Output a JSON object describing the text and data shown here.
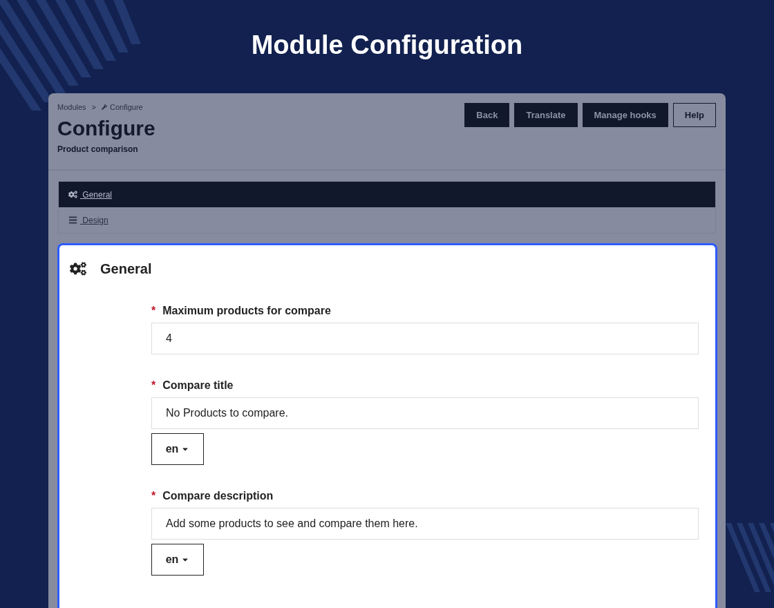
{
  "headline": "Module Configuration",
  "breadcrumb": [
    {
      "text": "Modules",
      "kind": "plain"
    },
    {
      "text": "Configure",
      "kind": "wrench"
    }
  ],
  "breadcrumb_separator": ">",
  "page_title": "Configure",
  "subtitle": "Product comparison",
  "buttons": [
    {
      "label": "Back",
      "kind": "dark"
    },
    {
      "label": "Translate",
      "kind": "dark"
    },
    {
      "label": "Manage hooks",
      "kind": "dark"
    },
    {
      "label": "Help",
      "kind": "outline"
    }
  ],
  "tabs": [
    {
      "label": "General",
      "kind": "gears",
      "selected": true
    },
    {
      "label": "Design",
      "kind": "lines",
      "selected": false
    }
  ],
  "section": {
    "title": "General"
  },
  "required_mark": "*",
  "fields": [
    {
      "label": "Maximum products for compare",
      "required": true,
      "value": "4"
    },
    {
      "label": "Compare title",
      "required": true,
      "value": "No Products to compare.",
      "language": "en"
    },
    {
      "label": "Compare description",
      "required": true,
      "value": "Add some products to see and compare them here.",
      "language": "en"
    }
  ]
}
